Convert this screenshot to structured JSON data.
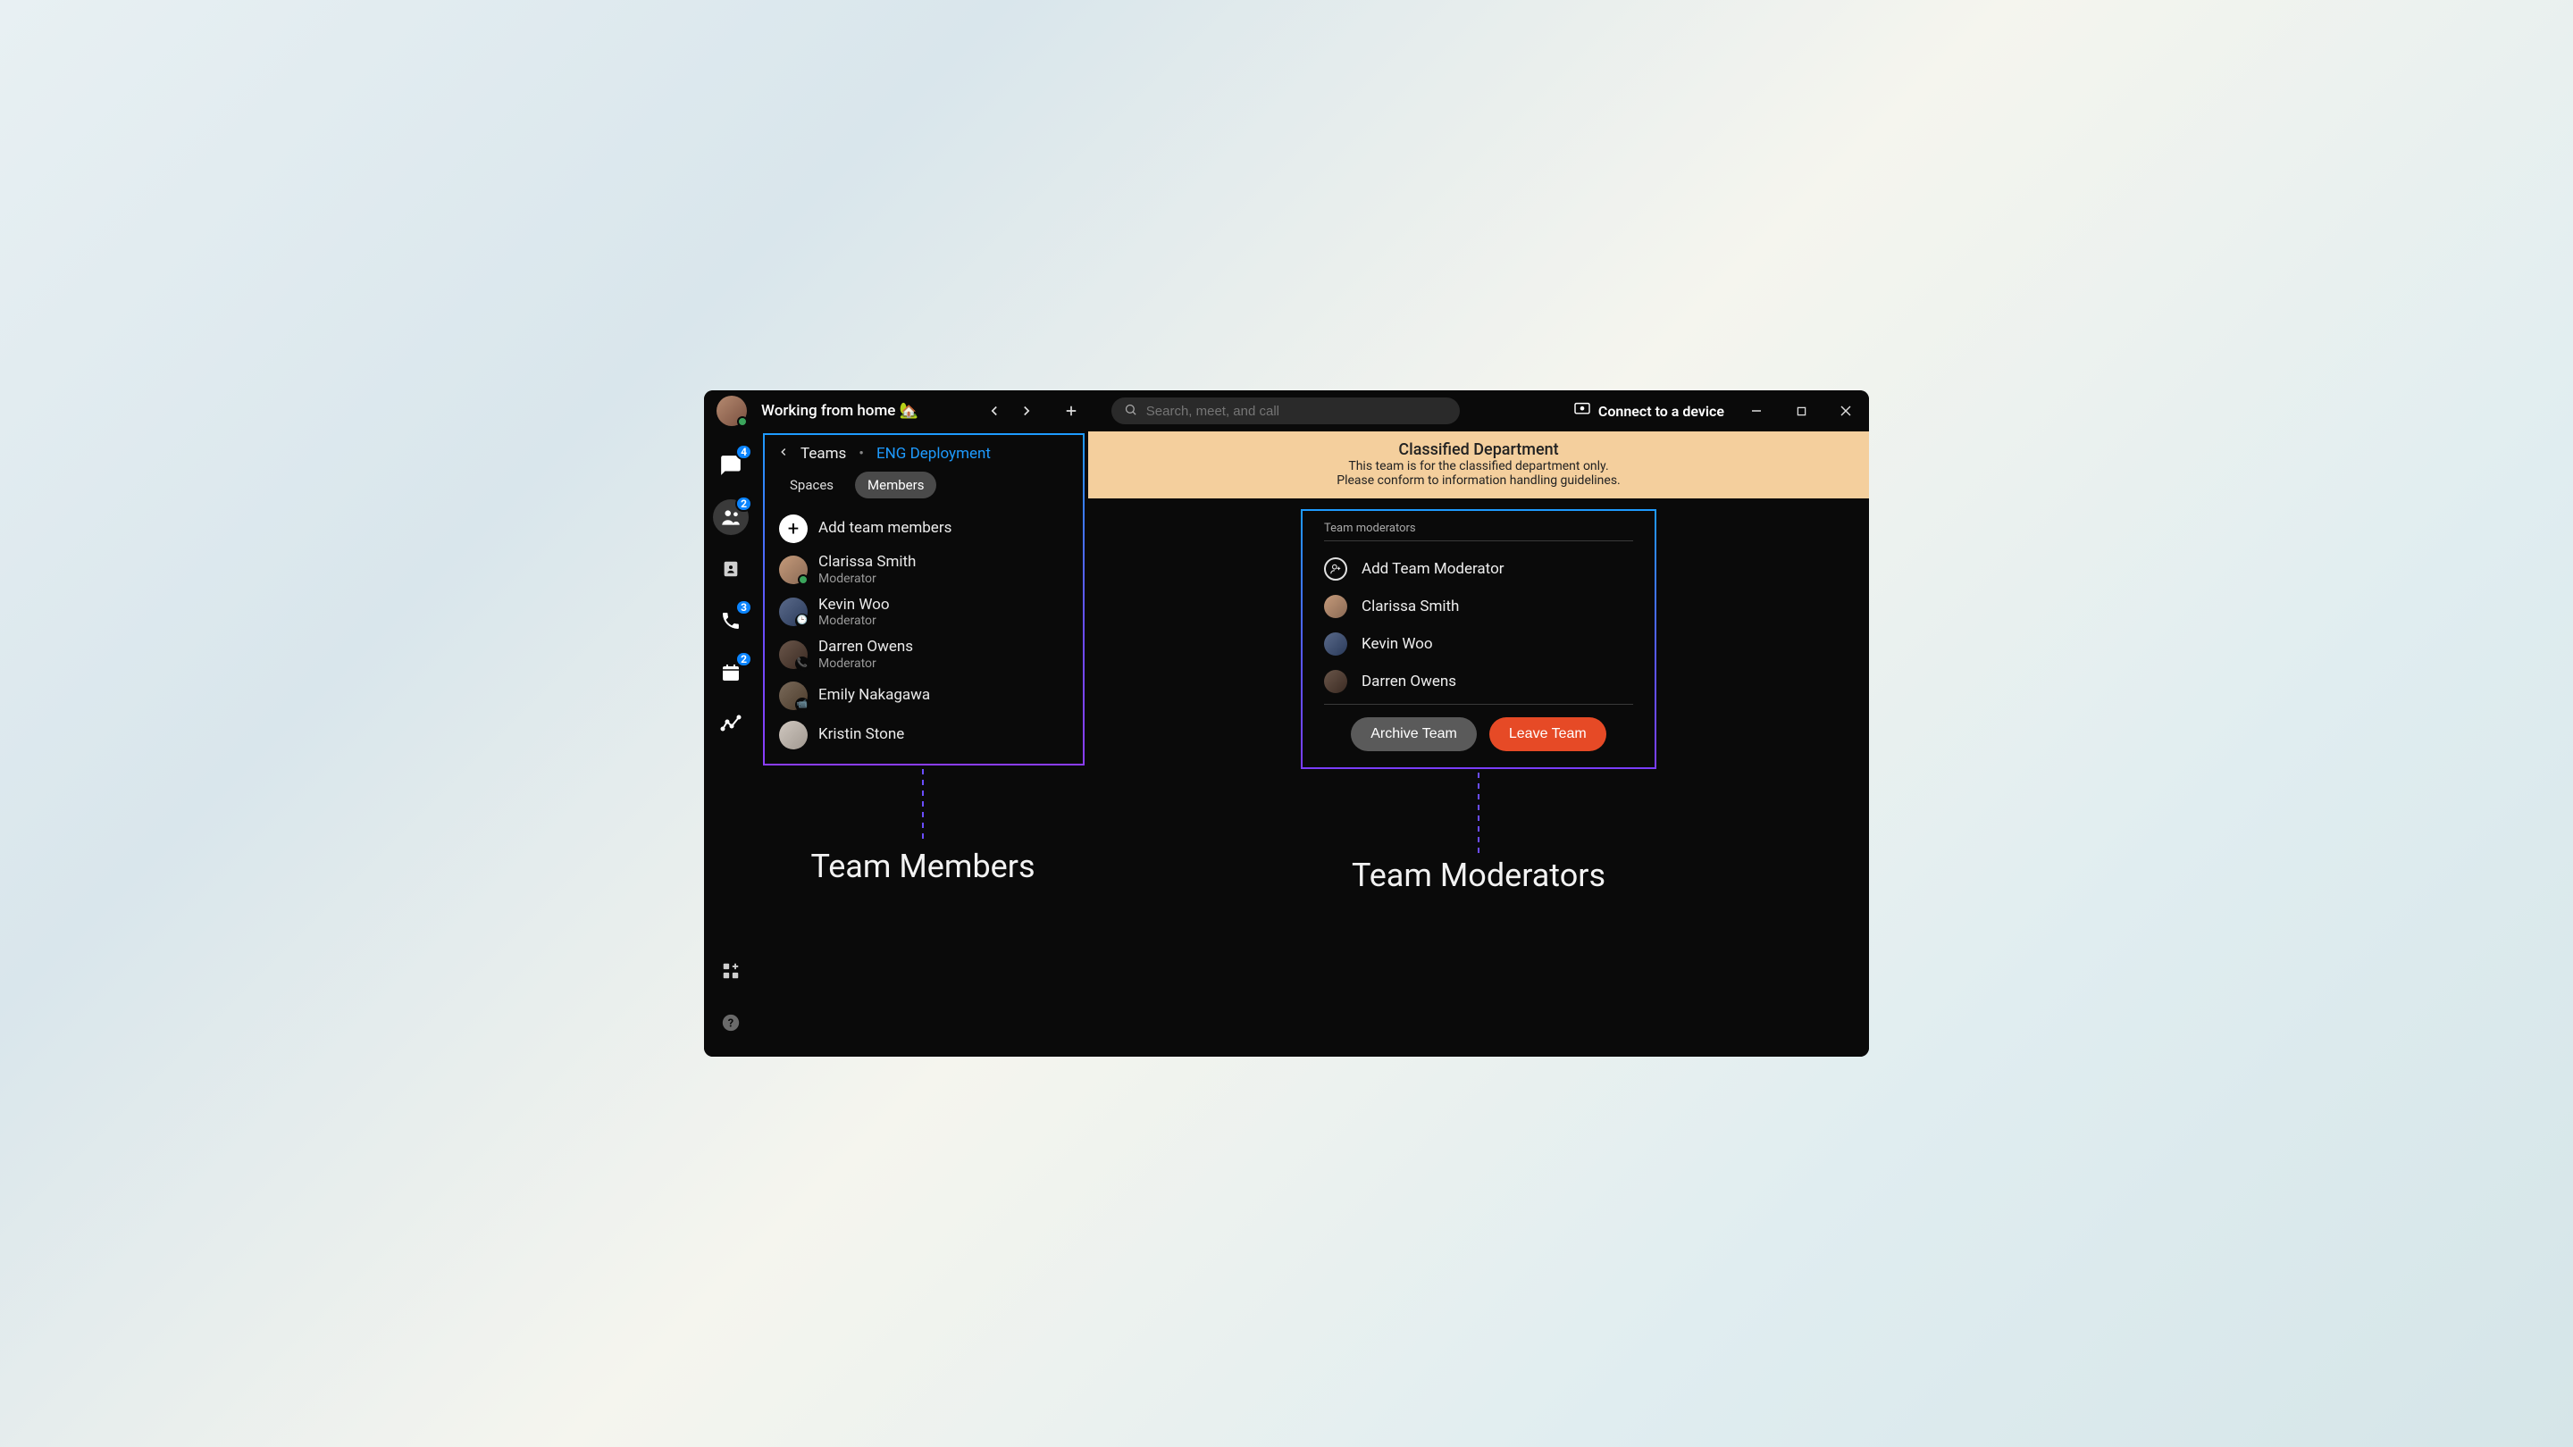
{
  "header": {
    "status_text": "Working from home 🏡",
    "search_placeholder": "Search, meet, and call",
    "connect_label": "Connect to a device"
  },
  "rail": {
    "items": [
      {
        "name": "chat",
        "badge": "4"
      },
      {
        "name": "teams",
        "badge": "2",
        "active": true
      },
      {
        "name": "contacts",
        "badge": null
      },
      {
        "name": "calls",
        "badge": "3"
      },
      {
        "name": "calendar",
        "badge": "2"
      },
      {
        "name": "activity",
        "badge": null
      }
    ]
  },
  "panel": {
    "back_label": "Teams",
    "team_name": "ENG Deployment",
    "tabs": {
      "spaces": "Spaces",
      "members": "Members",
      "active": "members"
    },
    "add_label": "Add team members",
    "members": [
      {
        "name": "Clarissa Smith",
        "role": "Moderator",
        "avatar": "av1",
        "status": "green"
      },
      {
        "name": "Kevin Woo",
        "role": "Moderator",
        "avatar": "av2",
        "status": "clock"
      },
      {
        "name": "Darren Owens",
        "role": "Moderator",
        "avatar": "av3",
        "status": "phone"
      },
      {
        "name": "Emily Nakagawa",
        "role": null,
        "avatar": "av4",
        "status": "video"
      },
      {
        "name": "Kristin Stone",
        "role": null,
        "avatar": "av5",
        "status": null
      }
    ],
    "caption": "Team Members"
  },
  "banner": {
    "title": "Classified Department",
    "line1": "This team is for the classified department only.",
    "line2": "Please conform to information handling guidelines."
  },
  "moderators": {
    "heading": "Team moderators",
    "add_label": "Add Team Moderator",
    "list": [
      {
        "name": "Clarissa Smith",
        "avatar": "av1"
      },
      {
        "name": "Kevin Woo",
        "avatar": "av2"
      },
      {
        "name": "Darren Owens",
        "avatar": "av3"
      }
    ],
    "archive_label": "Archive Team",
    "leave_label": "Leave Team",
    "caption": "Team Moderators"
  }
}
